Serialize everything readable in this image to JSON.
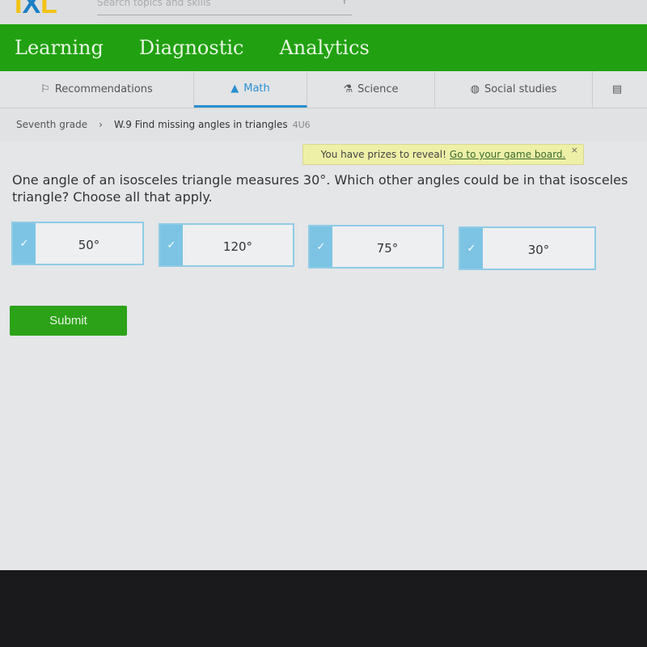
{
  "header": {
    "logo": "IXL",
    "search_placeholder": "Search topics and skills"
  },
  "main_nav": [
    "Learning",
    "Diagnostic",
    "Analytics"
  ],
  "subjects": [
    {
      "label": "Recommendations",
      "icon": "signpost-icon"
    },
    {
      "label": "Math",
      "icon": "pyramid-icon",
      "active": true
    },
    {
      "label": "Science",
      "icon": "flask-icon"
    },
    {
      "label": "Social studies",
      "icon": "globe-icon"
    }
  ],
  "breadcrumb": {
    "grade": "Seventh grade",
    "skill": "W.9 Find missing angles in triangles",
    "code": "4U6"
  },
  "prize": {
    "text": "You have prizes to reveal!",
    "link": "Go to your game board.",
    "close": "×"
  },
  "question": "One angle of an isosceles triangle measures 30°. Which other angles could be in that isosceles triangle? Choose all that apply.",
  "options": [
    "50°",
    "120°",
    "75°",
    "30°"
  ],
  "submit": "Submit",
  "accent": "#21a111"
}
